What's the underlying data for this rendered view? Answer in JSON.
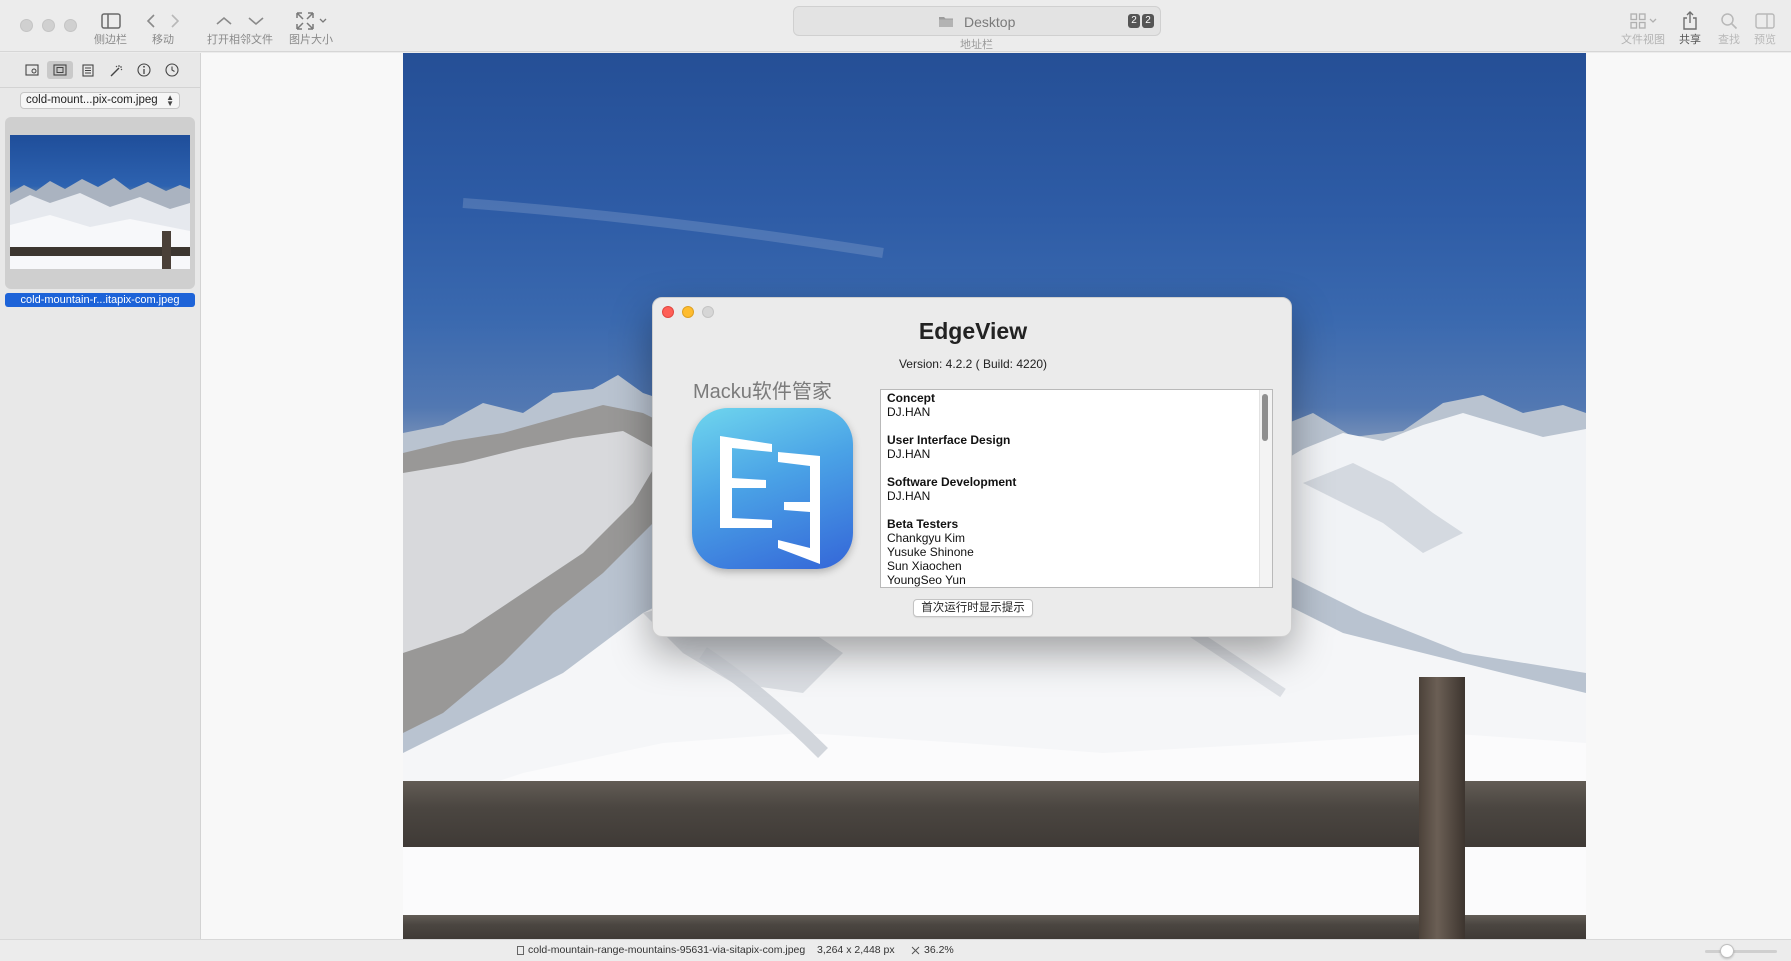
{
  "toolbar": {
    "sidebar_label": "侧边栏",
    "move_label": "移动",
    "neighbor_label": "打开相邻文件",
    "image_size_label": "图片大小",
    "address_text": "Desktop",
    "address_badge_1": "2",
    "address_badge_2": "2",
    "address_label": "地址栏",
    "file_view_label": "文件视图",
    "share_label": "共享",
    "find_label": "查找",
    "preview_label": "预览"
  },
  "sidebar": {
    "select_value": "cold-mount...pix-com.jpeg",
    "thumbnail_label": "cold-mountain-r...itapix-com.jpeg"
  },
  "dialog": {
    "title": "EdgeView",
    "version": "Version: 4.2.2 ( Build: 4220)",
    "watermark": "Macku软件管家",
    "credits": [
      {
        "title": "Concept",
        "names": [
          "DJ.HAN"
        ]
      },
      {
        "title": "User Interface Design",
        "names": [
          "DJ.HAN"
        ]
      },
      {
        "title": "Software Development",
        "names": [
          "DJ.HAN"
        ]
      },
      {
        "title": "Beta Testers",
        "names": [
          "Chankgyu Kim",
          "Yusuke Shinone",
          "Sun Xiaochen",
          "YoungSeo Yun"
        ]
      }
    ],
    "button_label": "首次运行时显示提示"
  },
  "status": {
    "filename": "cold-mountain-range-mountains-95631-via-sitapix-com.jpeg",
    "dimensions": "3,264 x 2,448 px",
    "zoom": "36.2%"
  },
  "colors": {
    "selection": "#1d63d8",
    "close": "#fe5f57",
    "minimize": "#febc2e"
  }
}
